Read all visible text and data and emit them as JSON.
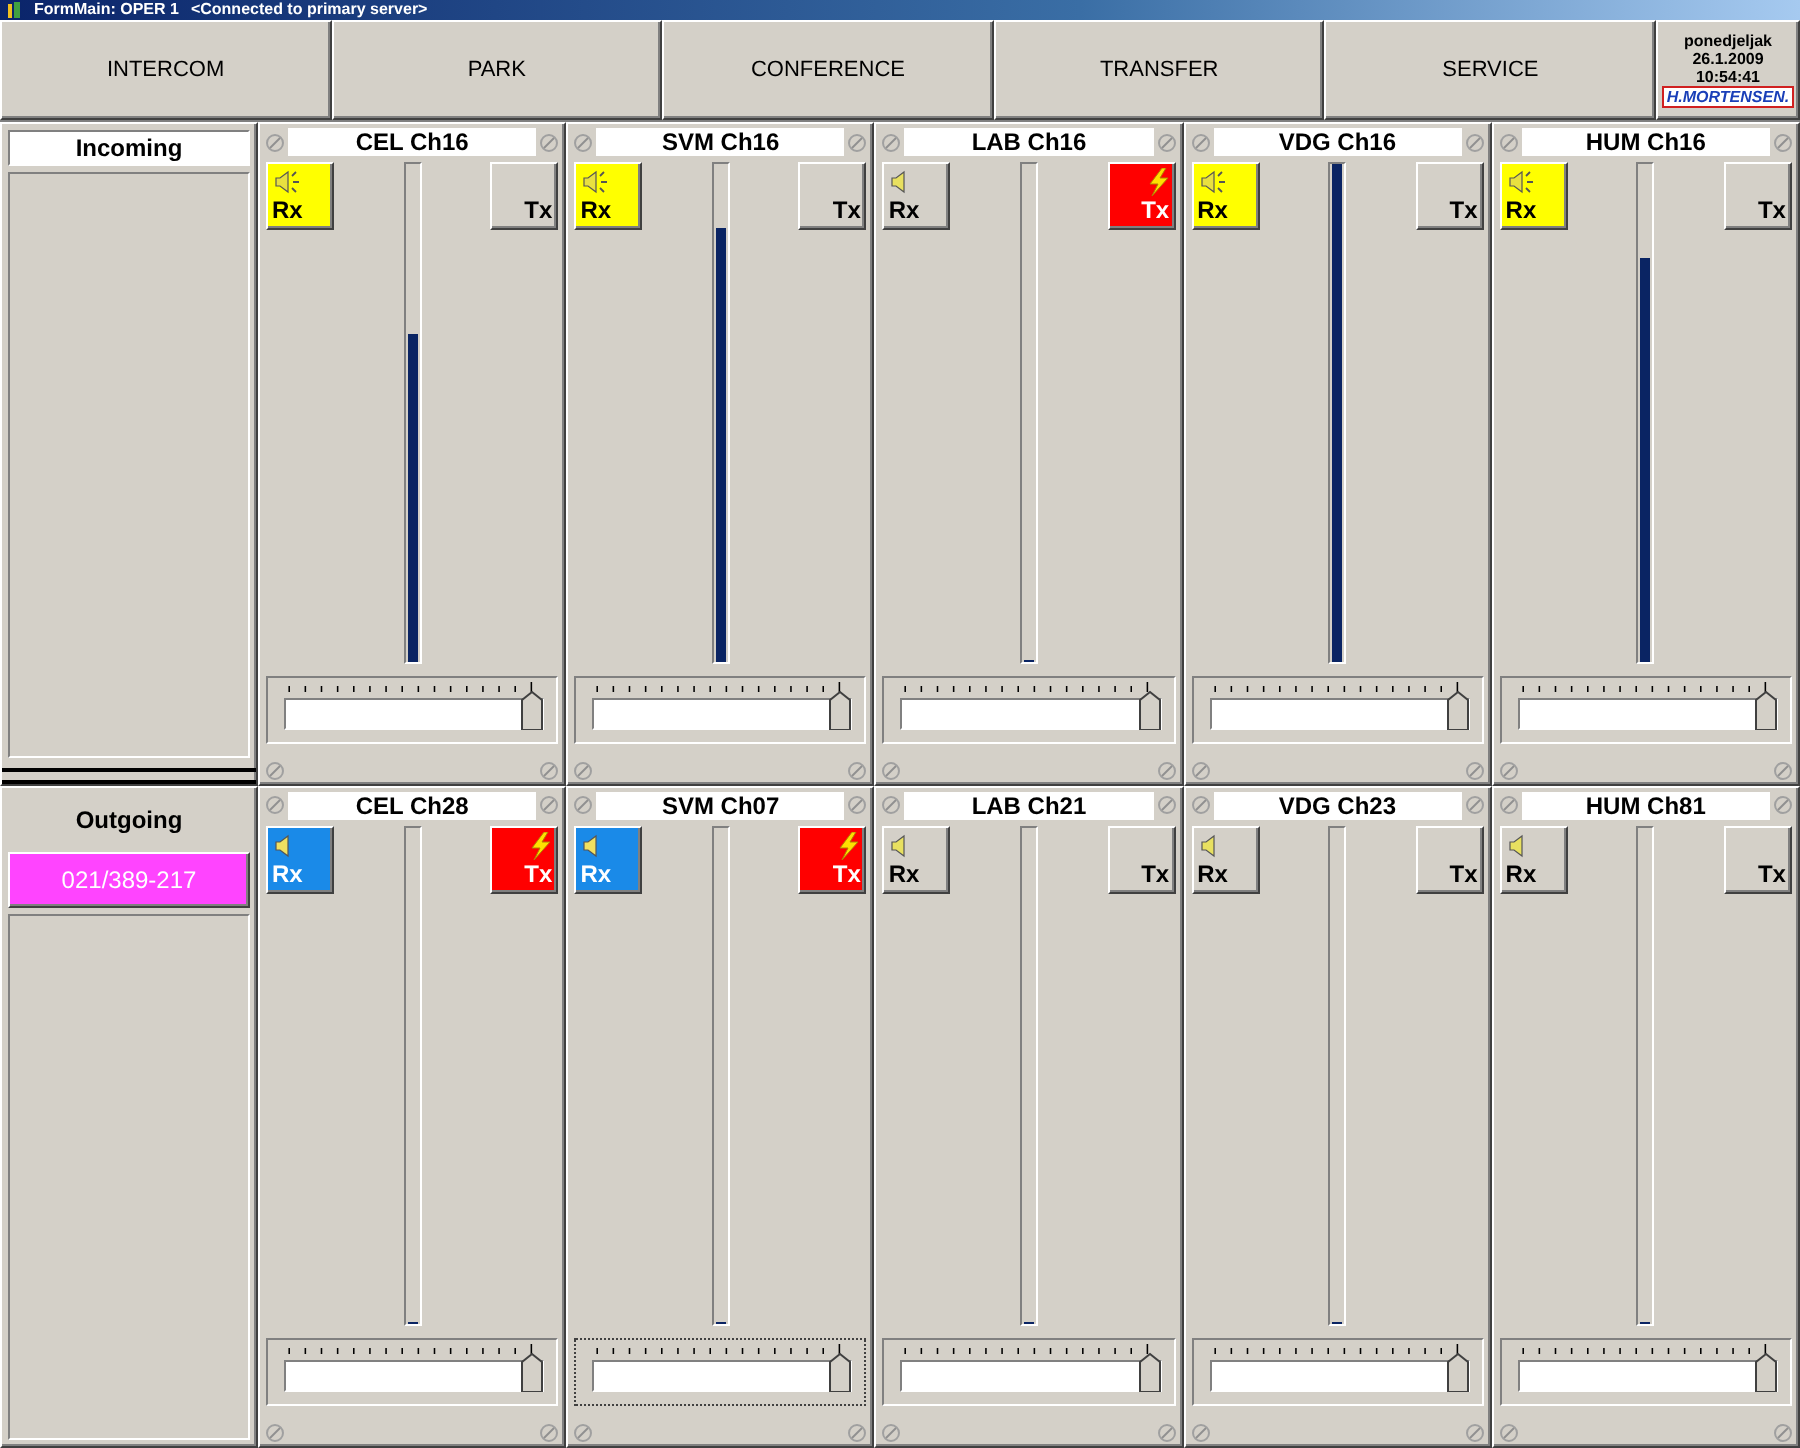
{
  "window": {
    "title": "FormMain: OPER 1",
    "status": "<Connected to primary server>"
  },
  "nav_buttons": [
    "INTERCOM",
    "PARK",
    "CONFERENCE",
    "TRANSFER",
    "SERVICE"
  ],
  "clock": {
    "day": "ponedjeljak",
    "date": "26.1.2009",
    "time": "10:54:41",
    "operator": "H.MORTENSEN."
  },
  "incoming": {
    "title": "Incoming"
  },
  "outgoing": {
    "title": "Outgoing",
    "calls": [
      {
        "number": "021/389-217",
        "color": "#ff44ff"
      }
    ]
  },
  "rows": [
    {
      "channels": [
        {
          "name": "CEL Ch16",
          "rx_active": true,
          "rx_selected": false,
          "rx_label": "Rx",
          "tx_label": "Tx",
          "tx_on": false,
          "meter": {
            "level": 0.66
          },
          "volume": {
            "level": 1,
            "focused": false
          }
        },
        {
          "name": "SVM Ch16",
          "rx_active": true,
          "rx_selected": false,
          "rx_label": "Rx",
          "tx_label": "Tx",
          "tx_on": false,
          "meter": {
            "level": 0.87
          },
          "volume": {
            "level": 1,
            "focused": false
          }
        },
        {
          "name": "LAB Ch16",
          "rx_active": false,
          "rx_selected": false,
          "rx_label": "Rx",
          "tx_label": "Tx",
          "tx_on": true,
          "meter": {
            "level": 0
          },
          "volume": {
            "level": 1,
            "focused": false
          }
        },
        {
          "name": "VDG Ch16",
          "rx_active": true,
          "rx_selected": false,
          "rx_label": "Rx",
          "tx_label": "Tx",
          "tx_on": false,
          "meter": {
            "level": 1
          },
          "volume": {
            "level": 1,
            "focused": false
          }
        },
        {
          "name": "HUM Ch16",
          "rx_active": true,
          "rx_selected": false,
          "rx_label": "Rx",
          "tx_label": "Tx",
          "tx_on": false,
          "meter": {
            "level": 0.81
          },
          "volume": {
            "level": 1,
            "focused": false
          }
        }
      ]
    },
    {
      "channels": [
        {
          "name": "CEL Ch28",
          "rx_active": false,
          "rx_selected": true,
          "rx_label": "Rx",
          "tx_label": "Tx",
          "tx_on": true,
          "meter": {
            "level": 0
          },
          "volume": {
            "level": 1,
            "focused": false
          }
        },
        {
          "name": "SVM Ch07",
          "rx_active": false,
          "rx_selected": true,
          "rx_label": "Rx",
          "tx_label": "Tx",
          "tx_on": true,
          "meter": {
            "level": 0
          },
          "volume": {
            "level": 1,
            "focused": true
          }
        },
        {
          "name": "LAB Ch21",
          "rx_active": false,
          "rx_selected": false,
          "rx_label": "Rx",
          "tx_label": "Tx",
          "tx_on": false,
          "meter": {
            "level": 0
          },
          "volume": {
            "level": 1,
            "focused": false
          }
        },
        {
          "name": "VDG Ch23",
          "rx_active": false,
          "rx_selected": false,
          "rx_label": "Rx",
          "tx_label": "Tx",
          "tx_on": false,
          "meter": {
            "level": 0
          },
          "volume": {
            "level": 1,
            "focused": false
          }
        },
        {
          "name": "HUM Ch81",
          "rx_active": false,
          "rx_selected": false,
          "rx_label": "Rx",
          "tx_label": "Tx",
          "tx_on": false,
          "meter": {
            "level": 0
          },
          "volume": {
            "level": 1,
            "focused": false
          }
        }
      ]
    }
  ]
}
